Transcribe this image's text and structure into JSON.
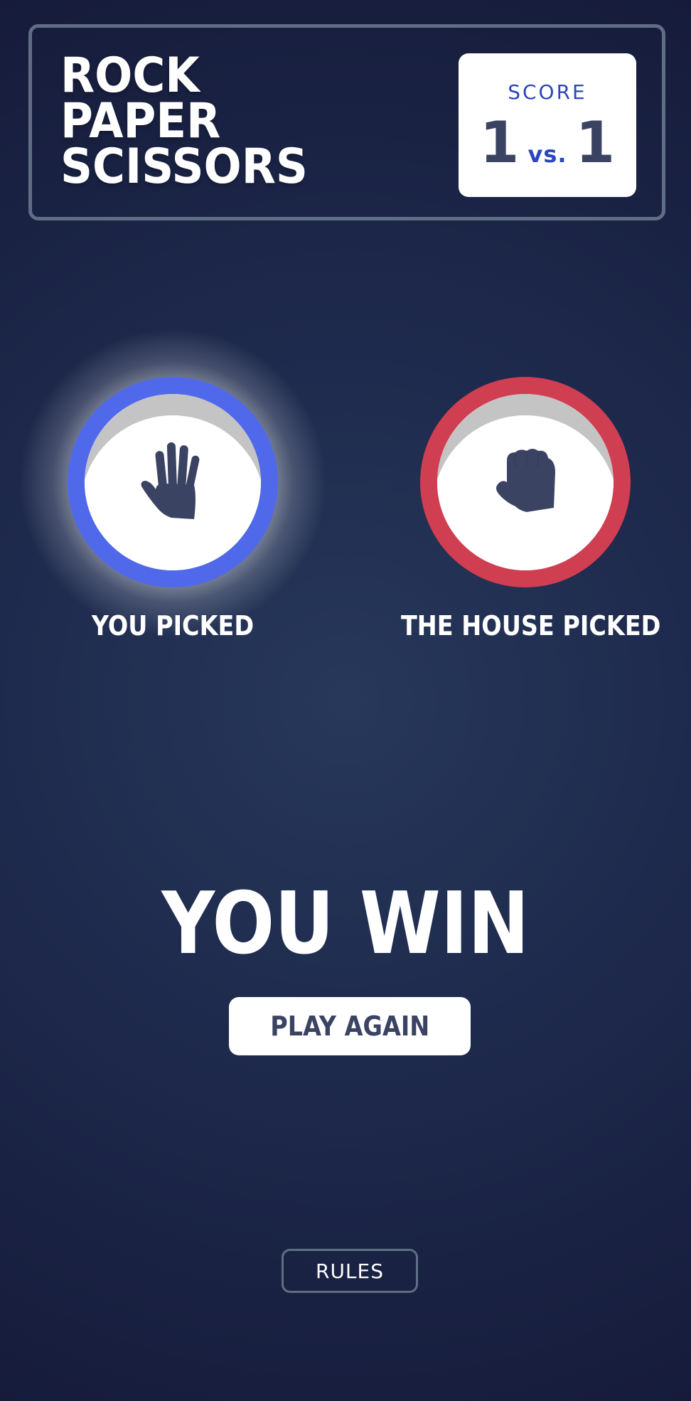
{
  "header": {
    "title_lines": [
      "ROCK",
      "PAPER",
      "SCISSORS"
    ],
    "score": {
      "label": "SCORE",
      "player": "1",
      "vs": "vs.",
      "house": "1"
    }
  },
  "player_pick": {
    "label": "YOU PICKED",
    "choice": "paper",
    "icon": "paper-hand-icon",
    "ring_color": "#4f69ea",
    "winner_glow": true
  },
  "house_pick": {
    "label": "THE HOUSE PICKED",
    "choice": "rock",
    "icon": "rock-fist-icon",
    "ring_color": "#d03e52"
  },
  "result": {
    "text": "YOU WIN",
    "play_again_label": "PLAY AGAIN"
  },
  "footer": {
    "rules_label": "RULES"
  },
  "colors": {
    "background_dark": "#161b3a",
    "background_light": "#27385a",
    "header_outline": "#606e85",
    "score_accent": "#2a46c0",
    "dark_text": "#3b4363"
  }
}
